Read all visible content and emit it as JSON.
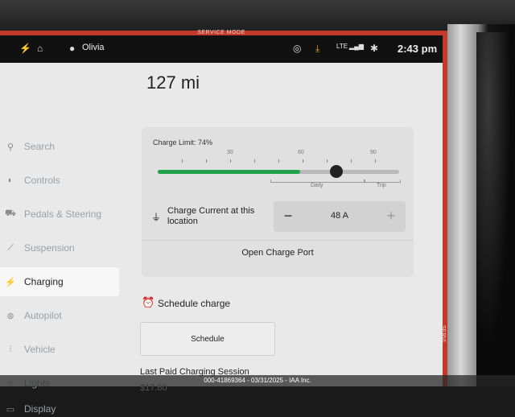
{
  "service_mode_label": "SERVICE MODE",
  "status": {
    "user_name": "Olivia",
    "network": "LTE",
    "time": "2:43 pm"
  },
  "sidebar": {
    "items": [
      {
        "label": "Search",
        "icon": "search-icon"
      },
      {
        "label": "Controls",
        "icon": "toggle-icon"
      },
      {
        "label": "Pedals & Steering",
        "icon": "car-icon"
      },
      {
        "label": "Suspension",
        "icon": "suspension-icon"
      },
      {
        "label": "Charging",
        "icon": "bolt-icon",
        "active": true
      },
      {
        "label": "Autopilot",
        "icon": "steering-wheel-icon"
      },
      {
        "label": "Vehicle",
        "icon": "sliders-icon"
      },
      {
        "label": "Lights",
        "icon": "light-icon"
      },
      {
        "label": "Display",
        "icon": "display-icon"
      }
    ]
  },
  "charging": {
    "range": "127 mi",
    "charge_limit_label": "Charge Limit: 74%",
    "charge_limit_fraction": 0.74,
    "slider_fill_fraction": 0.59,
    "tick_labels": [
      "30",
      "60",
      "90"
    ],
    "daily_label": "Daily",
    "trip_label": "Trip",
    "charge_current_label": "Charge Current at this location",
    "charge_current_value": "48 A",
    "minus_label": "−",
    "plus_label": "+",
    "open_charge_port": "Open Charge Port",
    "accent_color": "#22a34a"
  },
  "schedule": {
    "title": "Schedule charge",
    "button_label": "Schedule"
  },
  "last_paid": {
    "title": "Last Paid Charging Session",
    "amount": "$17.60"
  },
  "watermark": "000-41869364 - 03/31/2025 - IAA Inc.",
  "side_service_label": "SERVI"
}
